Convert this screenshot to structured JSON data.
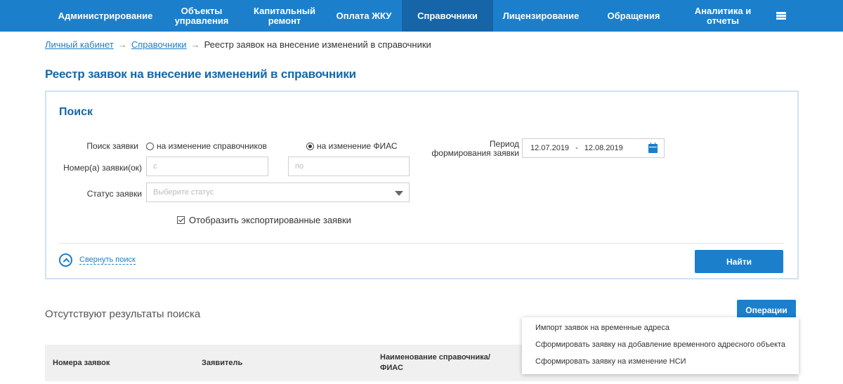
{
  "nav": {
    "items": [
      {
        "label": "Администрирование",
        "active": false
      },
      {
        "label": "Объекты\nуправления",
        "active": false
      },
      {
        "label": "Капитальный\nремонт",
        "active": false
      },
      {
        "label": "Оплата ЖКУ",
        "active": false
      },
      {
        "label": "Справочники",
        "active": true
      },
      {
        "label": "Лицензирование",
        "active": false
      },
      {
        "label": "Обращения",
        "active": false
      },
      {
        "label": "Аналитика и\nотчеты",
        "active": false
      }
    ],
    "menu_icon": "hamburger-menu-icon"
  },
  "breadcrumb": {
    "items": [
      "Личный кабинет",
      "Справочники"
    ],
    "current": "Реестр заявок на внесение изменений в справочники",
    "separator": "→"
  },
  "page_title": "Реестр заявок на внесение изменений в справочники",
  "search": {
    "title": "Поиск",
    "request_search_label": "Поиск заявки",
    "radio_options": [
      {
        "label": "на изменение справочников",
        "selected": false
      },
      {
        "label": "на изменение ФИАС",
        "selected": true
      }
    ],
    "period_label": "Период\nформирования заявки",
    "date_from": "12.07.2019",
    "date_sep": "-",
    "date_to": "12.08.2019",
    "numbers_label": "Номер(а) заявки(ок)",
    "number_from_placeholder": "с",
    "number_to_placeholder": "по",
    "status_label": "Статус заявки",
    "status_placeholder": "Выберите статус",
    "show_exported_label": "Отобразить экспортированные заявки",
    "show_exported_checked": true,
    "collapse_label": "Свернуть поиск",
    "find_button": "Найти"
  },
  "results": {
    "empty_text": "Отсутствуют результаты поиска",
    "operations_button": "Операции",
    "operations_menu": [
      "Импорт заявок на временные адреса",
      "Сформировать заявку на добавление временного адресного объекта",
      "Сформировать заявку на изменение НСИ"
    ],
    "columns": [
      "Номера заявок",
      "Заявитель",
      "Наименование справочника/\nФИАС"
    ]
  },
  "colors": {
    "accent": "#1b7fcc",
    "nav_active": "#1565a8",
    "title": "#1567a8"
  }
}
